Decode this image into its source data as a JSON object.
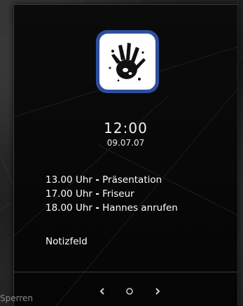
{
  "clock": {
    "time": "12:00",
    "date": "09.07.07"
  },
  "notes": [
    {
      "time": "13.00 Uhr",
      "separator": "-",
      "text": "Präsentation"
    },
    {
      "time": "17.00 Uhr",
      "separator": "-",
      "text": "Friseur"
    },
    {
      "time": "18.00 Uhr",
      "separator": "-",
      "text": "Hannes anrufen"
    }
  ],
  "notefield": {
    "label": "Notizfeld"
  },
  "navigation": {
    "prev_icon": "chevron-left-icon",
    "page_icon": "circle-icon",
    "next_icon": "chevron-right-icon"
  },
  "lock": {
    "label": "Sperren"
  },
  "logo": {
    "icon": "hand-print-icon",
    "border_color": "#2e4f9e"
  }
}
